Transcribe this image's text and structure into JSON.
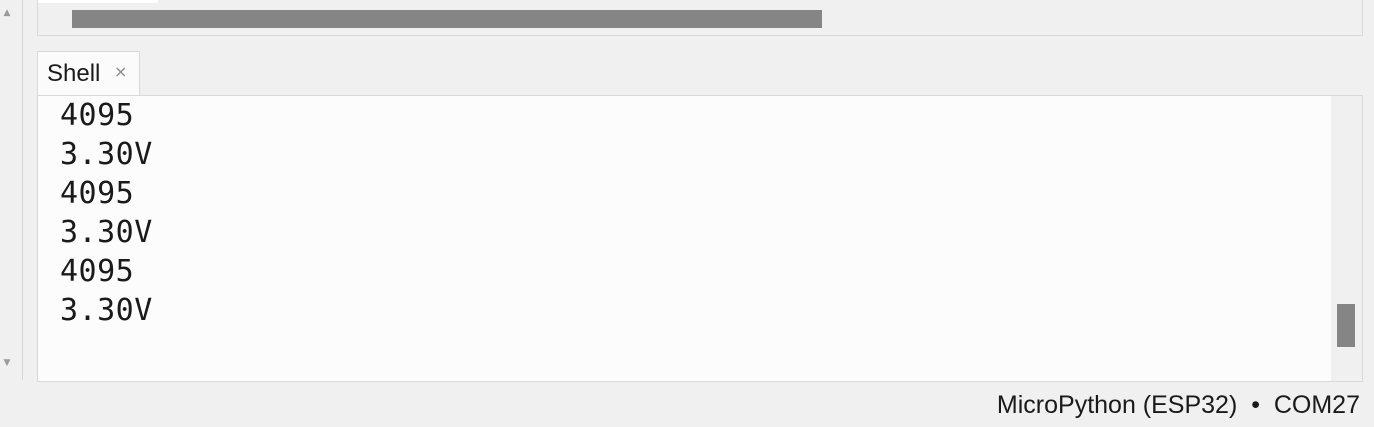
{
  "shell_tab": {
    "label": "Shell",
    "close_glyph": "×"
  },
  "shell_output": {
    "lines": [
      "4095",
      "3.30V",
      "4095",
      "3.30V",
      "4095",
      "3.30V"
    ]
  },
  "status_bar": {
    "interpreter": "MicroPython (ESP32)",
    "separator": "•",
    "port": "COM27"
  },
  "icons": {
    "scroll_up": "triangle-up",
    "scroll_down": "triangle-down",
    "tab_close": "close-x"
  },
  "colors": {
    "background": "#f0f0f0",
    "panel": "#fcfcfc",
    "scroll_thumb": "#858585",
    "text": "#1a1a1a"
  }
}
